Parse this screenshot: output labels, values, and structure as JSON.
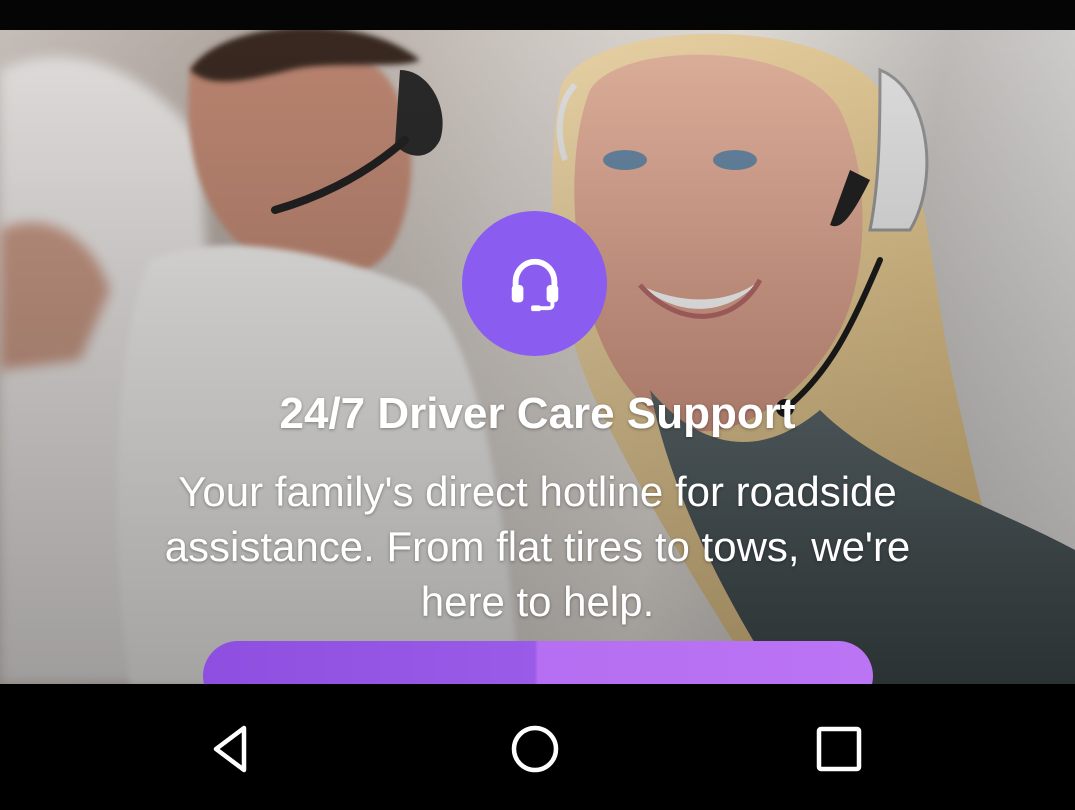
{
  "hero": {
    "icon": "headset-icon",
    "title": "24/7 Driver Care Support",
    "description": "Your family's direct hotline for roadside assistance. From flat tires to tows, we're here to help."
  },
  "colors": {
    "accent": "#8b5cf0",
    "button_left": "#9a5be8",
    "button_right": "#bb74f4",
    "text": "#ffffff"
  },
  "navigation_bar": {
    "back_icon": "back-triangle-icon",
    "home_icon": "home-circle-icon",
    "recents_icon": "recents-square-icon"
  }
}
